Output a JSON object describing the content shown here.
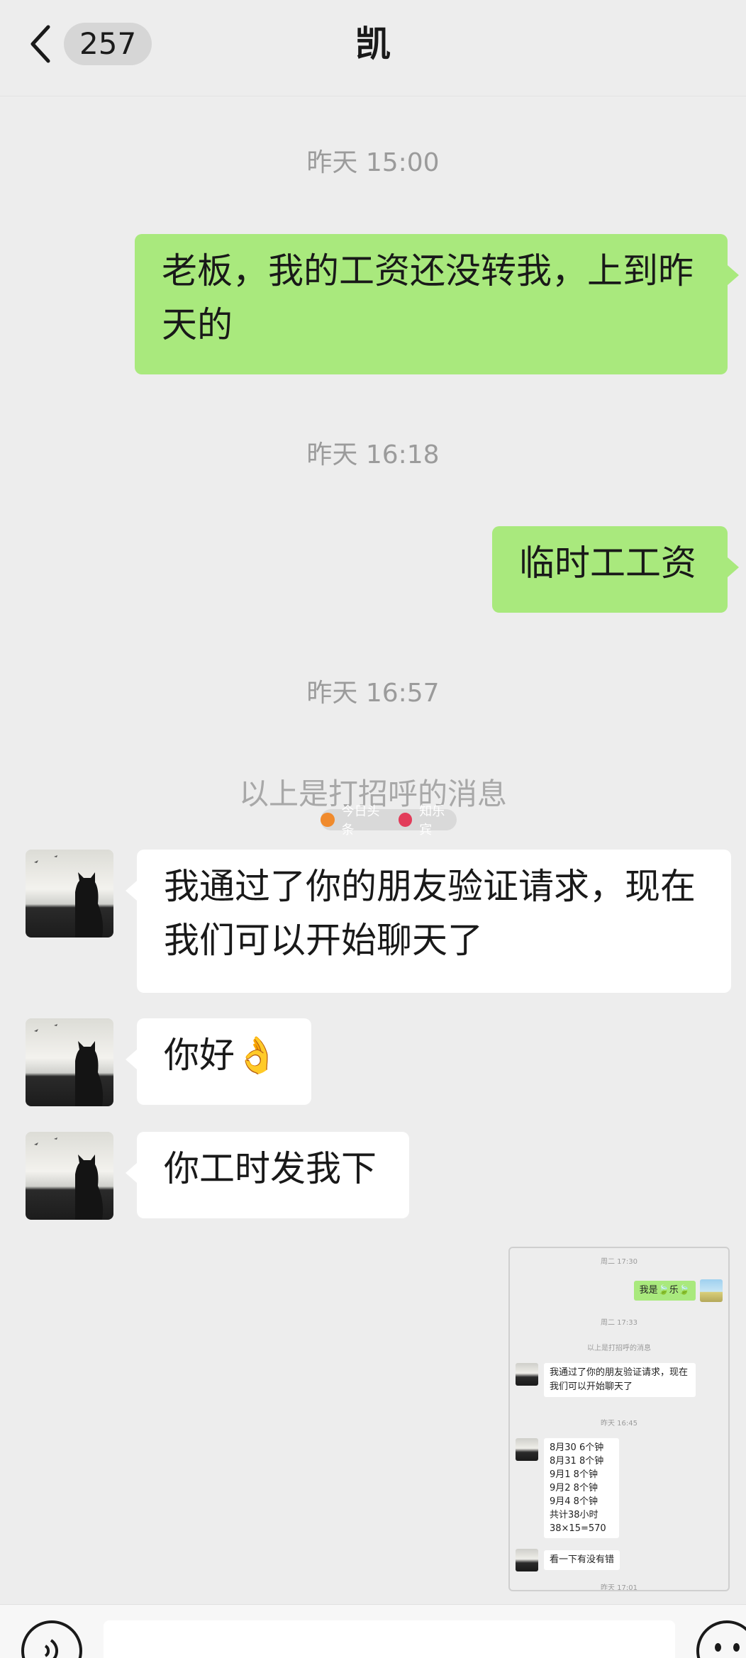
{
  "header": {
    "unread_count": "257",
    "title": "凯"
  },
  "messages": {
    "ts1": "昨天 15:00",
    "out1": "老板，我的工资还没转我，上到昨天的",
    "ts2": "昨天 16:18",
    "out2": "临时工工资",
    "ts3": "昨天 16:57",
    "system": "以上是打招呼的消息",
    "in1": "我通过了你的朋友验证请求，现在我们可以开始聊天了",
    "in2": "你好",
    "in2_emoji": "👌",
    "in3": "你工时发我下"
  },
  "watermark": {
    "left": "今日头条",
    "right": "知乐宾"
  },
  "screenshot": {
    "ts1": "周二 17:30",
    "out": "我是🍃乐🍃",
    "ts2": "周二 17:33",
    "system": "以上是打招呼的消息",
    "in1": "我通过了你的朋友验证请求，现在\n我们可以开始聊天了",
    "ts3": "昨天 16:45",
    "hours": "8月30  6个钟\n8月31  8个钟\n9月1    8个钟\n9月2    8个钟\n9月4     8个钟\n共计38小时\n38×15=570",
    "in3": "看一下有没有错",
    "ts4": "昨天 17:01"
  },
  "icons": {
    "back": "chevron-left-icon",
    "voice": "voice-icon",
    "emoji": "emoji-icon"
  },
  "colors": {
    "background": "#ededed",
    "outgoing_bubble": "#a9e97d",
    "incoming_bubble": "#ffffff",
    "timestamp": "#9b9b9b"
  }
}
